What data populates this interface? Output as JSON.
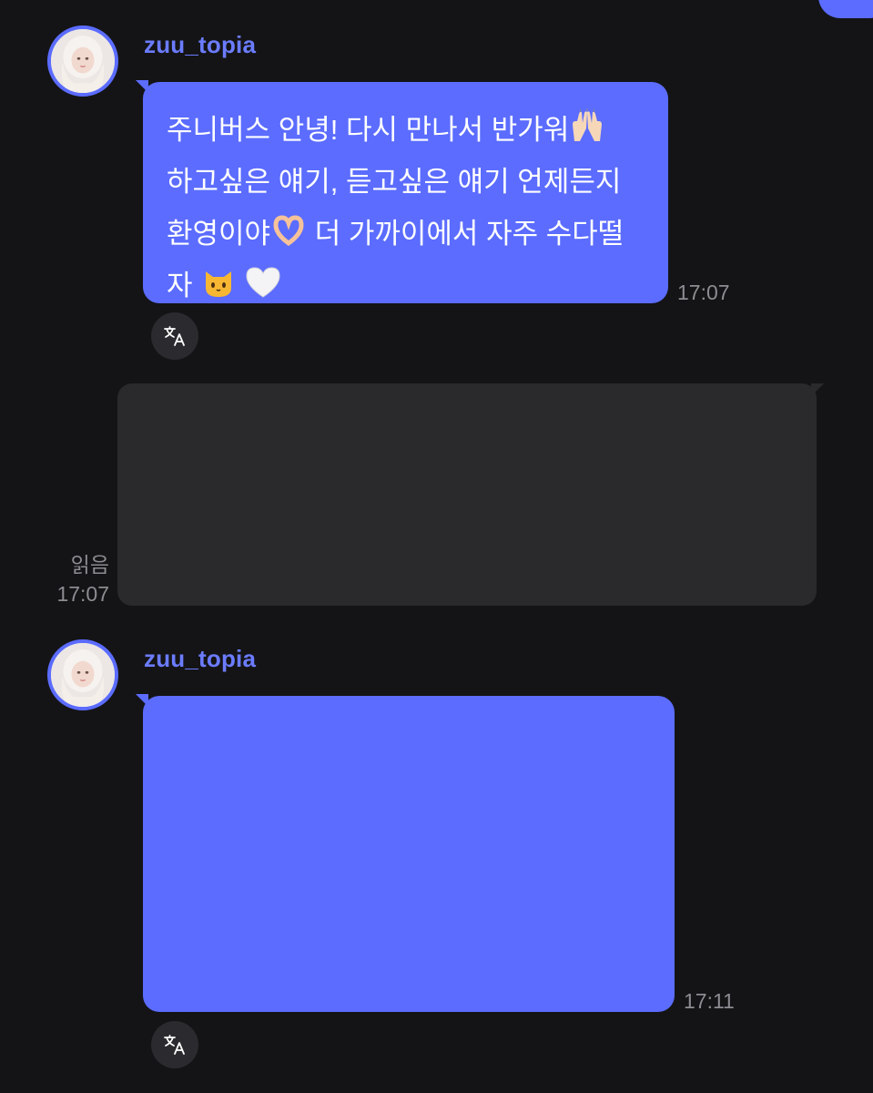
{
  "messages": [
    {
      "sender": "zuu_topia",
      "text_lines": [
        "주니버스 안녕! 다시 만나서 반가워",
        "하고싶은 얘기, 듣고싶은 얘기 언제든지",
        "환영이야",
        "더 가까이에서 자주 수다떨",
        "자"
      ],
      "emojis": [
        "raised-hands",
        "heart-hands",
        "cat-face",
        "white-heart"
      ],
      "time": "17:07"
    },
    {
      "direction": "outgoing",
      "read_label": "읽음",
      "time": "17:07"
    },
    {
      "sender": "zuu_topia",
      "time": "17:11"
    }
  ],
  "colors": {
    "background": "#141416",
    "accent": "#5b6cff",
    "sender_name": "#6b7cff",
    "outgoing_bubble": "#2a2a2d",
    "timestamp": "#8c8c92",
    "translate_button": "#2b2b2f"
  },
  "icons": {
    "translate": "translate-icon",
    "avatar": "avatar"
  }
}
